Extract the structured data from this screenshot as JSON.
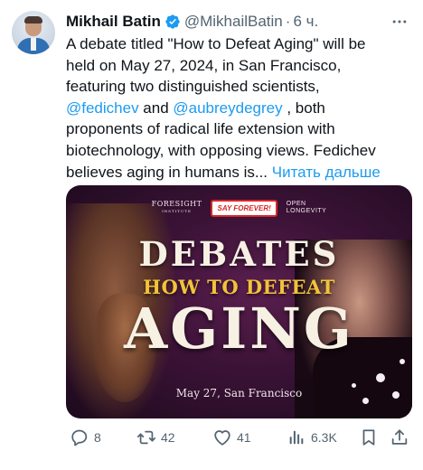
{
  "author": {
    "name": "Mikhail Batin",
    "handle": "@MikhailBatin",
    "separator": "·",
    "time": "6 ч."
  },
  "tweet": {
    "lines": [
      [
        "A debate titled \"How to Defeat Aging\" will be"
      ],
      [
        "held on May 27, 2024,  in San Francisco,"
      ],
      [
        "featuring two distinguished scientists,"
      ],
      [
        "@fedichev",
        " and ",
        "@aubreydegrey",
        " , both"
      ],
      [
        "proponents of radical life extension with"
      ],
      [
        "biotechnology, with opposing views. Fedichev"
      ],
      [
        "believes aging in humans is... ",
        "Читать дальше"
      ]
    ],
    "mention_1": "@fedichev",
    "mention_2": "@aubreydegrey",
    "read_more": "Читать дальше"
  },
  "media": {
    "logo_left_main": "FORESIGHT",
    "logo_left_sub": "INSTITUTE",
    "logo_center": "SAY FOREVER!",
    "logo_right_line1": "OPEN",
    "logo_right_line2": "LONGEVITY",
    "title_1": "DEBATES",
    "title_2": "HOW TO DEFEAT",
    "title_3": "AGING",
    "date_place": "May 27, San Francisco"
  },
  "actions": {
    "replies": "8",
    "reposts": "42",
    "likes": "41",
    "views": "6.3K"
  },
  "colors": {
    "link": "#1d9bf0",
    "secondary_text": "#536471",
    "verified": "#1d9bf0"
  },
  "icons": [
    "verified-badge-icon",
    "more-icon",
    "reply-icon",
    "retweet-icon",
    "like-icon",
    "views-icon",
    "bookmark-icon",
    "share-icon"
  ]
}
